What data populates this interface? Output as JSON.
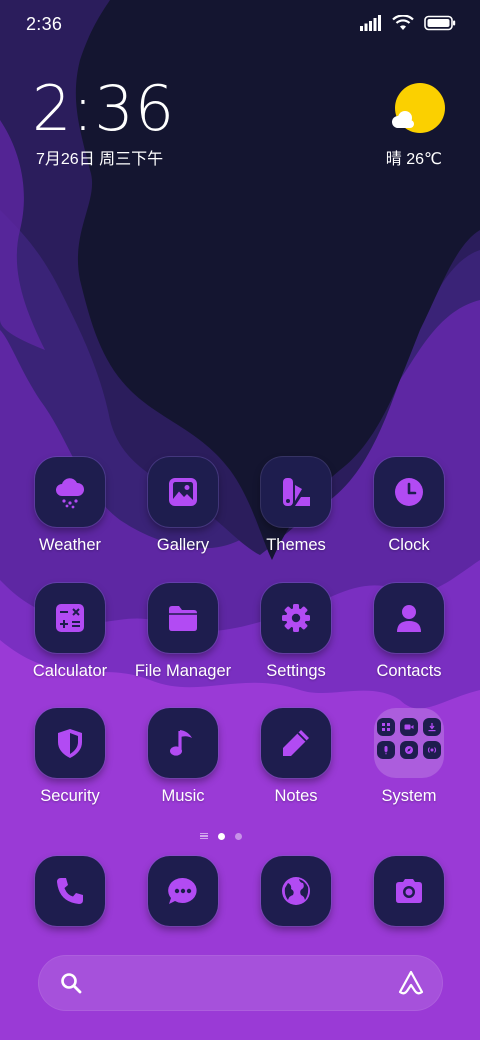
{
  "status_bar": {
    "time": "2:36",
    "icons": [
      "signal-icon",
      "wifi-icon",
      "battery-icon"
    ]
  },
  "clock_widget": {
    "time": "2:36",
    "date": "7月26日 周三下午"
  },
  "weather_widget": {
    "text": "晴 26℃",
    "icon": "sunny-cloud-icon"
  },
  "apps": [
    {
      "label": "Weather",
      "icon": "weather-icon"
    },
    {
      "label": "Gallery",
      "icon": "gallery-icon"
    },
    {
      "label": "Themes",
      "icon": "themes-icon"
    },
    {
      "label": "Clock",
      "icon": "clock-icon"
    },
    {
      "label": "Calculator",
      "icon": "calculator-icon"
    },
    {
      "label": "File Manager",
      "icon": "folder-icon"
    },
    {
      "label": "Settings",
      "icon": "gear-icon"
    },
    {
      "label": "Contacts",
      "icon": "person-icon"
    },
    {
      "label": "Security",
      "icon": "shield-icon"
    },
    {
      "label": "Music",
      "icon": "music-note-icon"
    },
    {
      "label": "Notes",
      "icon": "pencil-icon"
    },
    {
      "label": "System",
      "icon": "folder-grid-icon"
    }
  ],
  "page_indicator": {
    "pages": 2,
    "active": 1
  },
  "dock": [
    {
      "icon": "phone-icon"
    },
    {
      "icon": "messages-icon"
    },
    {
      "icon": "browser-globe-icon"
    },
    {
      "icon": "camera-icon"
    }
  ],
  "search_bar": {
    "left_icon": "search-icon",
    "right_icon": "assistant-icon"
  },
  "colors": {
    "accent": "#b24bf3",
    "icon_background": "#1e1d4e",
    "wallpaper_dark": "#141530",
    "wallpaper_purple": "#9a3ad6",
    "sun": "#fbd000"
  }
}
